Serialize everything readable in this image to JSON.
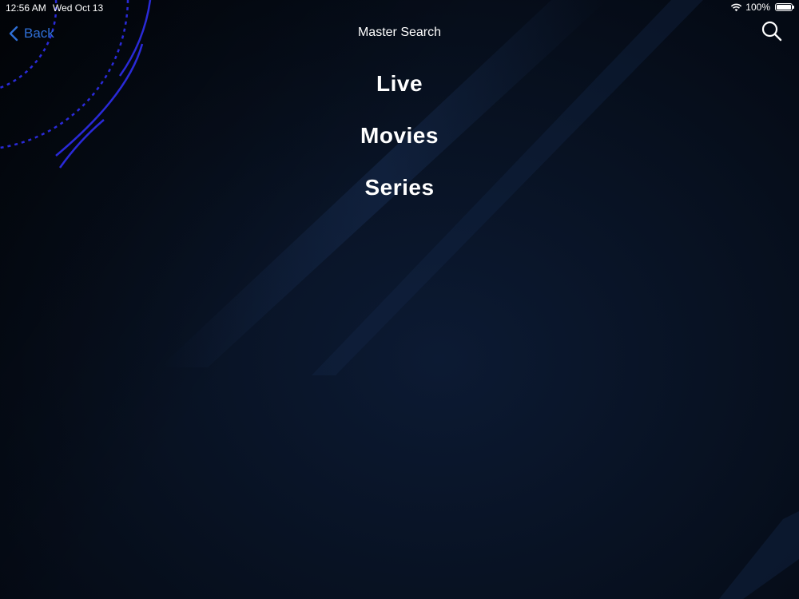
{
  "status_bar": {
    "time": "12:56 AM",
    "date": "Wed Oct 13",
    "battery_label": "100%",
    "battery_level": 1.0,
    "icons": [
      "wifi-icon",
      "battery-icon"
    ]
  },
  "nav": {
    "back_label": "Back",
    "back_icon": "chevron-left-icon",
    "title": "Master Search",
    "search_icon": "search-icon"
  },
  "categories": [
    {
      "label": "Live"
    },
    {
      "label": "Movies"
    },
    {
      "label": "Series"
    }
  ],
  "colors": {
    "background": "#050a14",
    "accent": "#2f6fd6",
    "text": "#ffffff",
    "decoration": "#2a2ad8"
  }
}
